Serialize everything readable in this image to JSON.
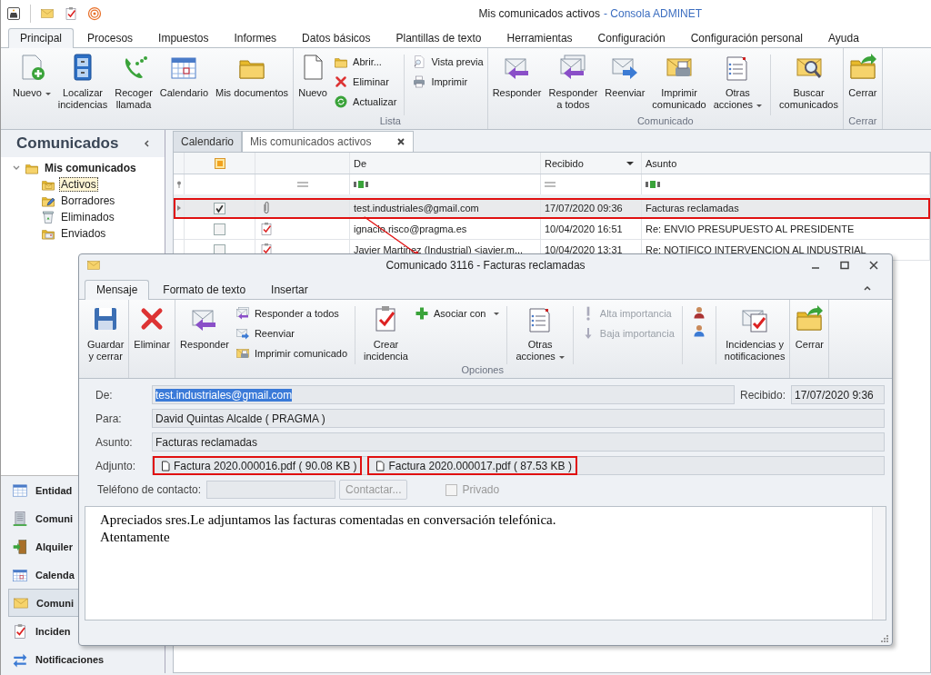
{
  "window": {
    "title": "Mis comunicados activos",
    "app_name": "- Consola ADMINET"
  },
  "ribbon_tabs": [
    {
      "label": "Principal",
      "selected": true
    },
    {
      "label": "Procesos",
      "selected": false
    },
    {
      "label": "Impuestos",
      "selected": false
    },
    {
      "label": "Informes",
      "selected": false
    },
    {
      "label": "Datos básicos",
      "selected": false
    },
    {
      "label": "Plantillas de texto",
      "selected": false
    },
    {
      "label": "Herramientas",
      "selected": false
    },
    {
      "label": "Configuración",
      "selected": false
    },
    {
      "label": "Configuración personal",
      "selected": false
    },
    {
      "label": "Ayuda",
      "selected": false
    }
  ],
  "ribbon": {
    "groups": [
      {
        "items": [
          {
            "kind": "large",
            "label": "Nuevo",
            "dropdown": true
          },
          {
            "kind": "large",
            "label": "Localizar\nincidencias"
          },
          {
            "kind": "large",
            "label": "Recoger\nllamada"
          },
          {
            "kind": "large",
            "label": "Calendario"
          },
          {
            "kind": "large",
            "label": "Mis documentos"
          }
        ]
      },
      {
        "label": "Lista",
        "items": [
          {
            "kind": "large",
            "label": "Nuevo"
          },
          {
            "kind": "stack",
            "buttons": [
              {
                "label": "Abrir..."
              },
              {
                "label": "Eliminar"
              },
              {
                "label": "Actualizar"
              }
            ]
          },
          {
            "kind": "separator"
          },
          {
            "kind": "stack",
            "buttons": [
              {
                "label": "Vista previa"
              },
              {
                "label": "Imprimir"
              }
            ]
          }
        ]
      },
      {
        "label": "Comunicado",
        "items": [
          {
            "kind": "large",
            "label": "Responder"
          },
          {
            "kind": "large",
            "label": "Responder\na todos"
          },
          {
            "kind": "large",
            "label": "Reenviar"
          },
          {
            "kind": "large",
            "label": "Imprimir\ncomunicado"
          },
          {
            "kind": "large",
            "label": "Otras\nacciones",
            "dropdown": true
          },
          {
            "kind": "separator"
          },
          {
            "kind": "large",
            "label": "Buscar\ncomunicados"
          }
        ]
      },
      {
        "label": "Cerrar",
        "items": [
          {
            "kind": "large",
            "label": "Cerrar"
          }
        ]
      }
    ]
  },
  "side_pane": {
    "title": "Comunicados",
    "tree": [
      {
        "label": "Mis comunicados",
        "expanded": true,
        "selected": false,
        "children": [
          {
            "label": "Activos",
            "selected": true
          },
          {
            "label": "Borradores",
            "selected": false
          },
          {
            "label": "Eliminados",
            "selected": false
          },
          {
            "label": "Enviados",
            "selected": false
          }
        ]
      }
    ],
    "nav": [
      {
        "label": "Entidad",
        "selected": false
      },
      {
        "label": "Comuni",
        "selected": false
      },
      {
        "label": "Alquiler",
        "selected": false
      },
      {
        "label": "Calenda",
        "selected": false
      },
      {
        "label": "Comuni",
        "selected": true
      },
      {
        "label": "Inciden",
        "selected": false
      },
      {
        "label": "Notificaciones",
        "selected": false
      }
    ]
  },
  "document_tabs": [
    {
      "label": "Calendario",
      "selected": false,
      "closable": false
    },
    {
      "label": "Mis comunicados activos",
      "selected": true,
      "closable": true
    }
  ],
  "grid": {
    "columns": [
      {
        "label": "De",
        "sorted": false
      },
      {
        "label": "Recibido",
        "sorted": true
      },
      {
        "label": "Asunto",
        "sorted": false
      }
    ],
    "rows": [
      {
        "kind": "attachment",
        "checked": true,
        "selected": true,
        "highlighted": true,
        "from": "test.industriales@gmail.com",
        "received": "17/07/2020 09:36",
        "subject": "Facturas reclamadas"
      },
      {
        "kind": "task",
        "checked": false,
        "selected": false,
        "highlighted": false,
        "from": "ignacio.risco@pragma.es",
        "received": "10/04/2020 16:51",
        "subject": "Re: ENVIO PRESUPUESTO AL PRESIDENTE"
      },
      {
        "kind": "task",
        "checked": false,
        "selected": false,
        "highlighted": false,
        "from": "Javier Martinez (Industrial) <javier.m...",
        "received": "10/04/2020 13:31",
        "subject": "Re: NOTIFICO INTERVENCION AL INDUSTRIAL"
      }
    ]
  },
  "dialog": {
    "title": "Comunicado 3116 - Facturas reclamadas",
    "tabs": [
      {
        "label": "Mensaje",
        "selected": true
      },
      {
        "label": "Formato de texto",
        "selected": false
      },
      {
        "label": "Insertar",
        "selected": false
      }
    ],
    "ribbon": {
      "groups": [
        {
          "items": [
            {
              "kind": "large",
              "label": "Guardar\ny cerrar"
            }
          ]
        },
        {
          "items": [
            {
              "kind": "large",
              "label": "Eliminar"
            }
          ]
        },
        {
          "label": "Opciones",
          "items": [
            {
              "kind": "large",
              "label": "Responder"
            },
            {
              "kind": "stack",
              "buttons": [
                {
                  "label": "Responder a todos"
                },
                {
                  "label": "Reenviar"
                },
                {
                  "label": "Imprimir comunicado"
                }
              ]
            },
            {
              "kind": "separator"
            },
            {
              "kind": "large",
              "label": "Crear\nincidencia"
            },
            {
              "kind": "stack",
              "buttons": [
                {
                  "label": "Asociar con",
                  "dropdown": true
                }
              ]
            },
            {
              "kind": "separator"
            },
            {
              "kind": "large",
              "label": "Otras\nacciones",
              "dropdown": true
            },
            {
              "kind": "separator"
            },
            {
              "kind": "stack",
              "buttons": [
                {
                  "label": "Alta importancia",
                  "disabled": true
                },
                {
                  "label": "Baja importancia",
                  "disabled": true
                }
              ]
            },
            {
              "kind": "separator"
            },
            {
              "kind": "icon_stack"
            },
            {
              "kind": "separator"
            },
            {
              "kind": "large",
              "label": "Incidencias y\nnotificaciones"
            }
          ]
        },
        {
          "items": [
            {
              "kind": "large",
              "label": "Cerrar"
            }
          ]
        }
      ]
    },
    "form": {
      "from_label": "De:",
      "from": "test.industriales@gmail.com",
      "from_selected": true,
      "received_label": "Recibido:",
      "received": "17/07/2020 9:36",
      "to_label": "Para:",
      "to": "David Quintas Alcalde ( PRAGMA )",
      "subject_label": "Asunto:",
      "subject": "Facturas reclamadas",
      "attachments_label": "Adjunto:",
      "attachments": [
        {
          "name": "Factura 2020.000016.pdf ( 90.08 KB )",
          "highlighted": true
        },
        {
          "name": "Factura 2020.000017.pdf ( 87.53 KB )",
          "highlighted": true
        }
      ],
      "phone_label": "Teléfono de contacto:",
      "contact_button": {
        "label": "Contactar...",
        "disabled": true
      },
      "private": {
        "label": "Privado",
        "checked": false,
        "disabled": true
      }
    },
    "body": [
      "Apreciados sres.Le adjuntamos las facturas comentadas en conversación telefónica.",
      "Atentamente"
    ]
  }
}
